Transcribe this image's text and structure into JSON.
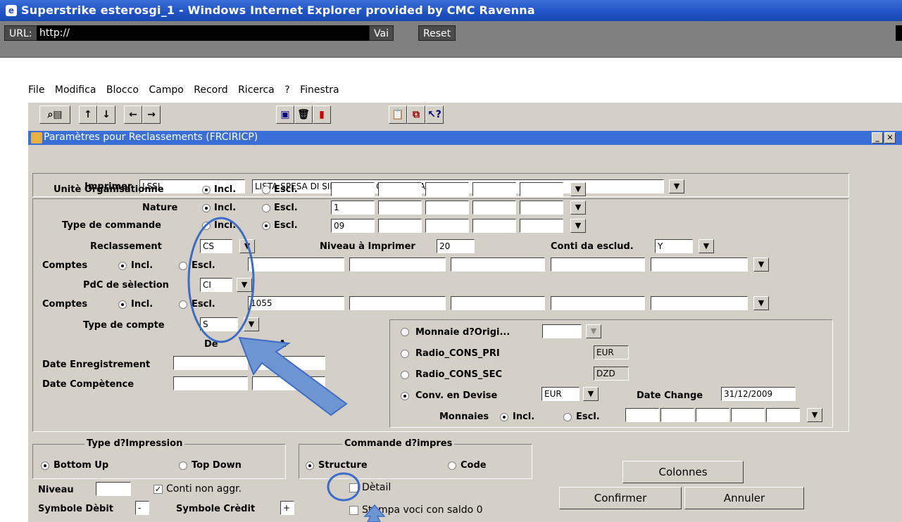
{
  "window": {
    "title": "Superstrike esterosgi_1 - Windows Internet Explorer provided by CMC Ravenna"
  },
  "urlbar": {
    "label": "URL:",
    "value": "http://",
    "go": "Vai",
    "reset": "Reset"
  },
  "menu": [
    "File",
    "Modifica",
    "Blocco",
    "Campo",
    "Record",
    "Ricerca",
    "?",
    "Finestra"
  ],
  "form": {
    "title": "Paramètres pour Reclassements (FRCIRICP)"
  },
  "imprimer": {
    "label": "Imprimer",
    "code": "LSSI",
    "desc": "LISTA SPESA DI SINTESI PER COMMESSA"
  },
  "rows": {
    "unite": {
      "label": "Unitè Organisationne",
      "incl": "Incl.",
      "escl": "Escl.",
      "values": [
        "",
        "",
        "",
        "",
        ""
      ]
    },
    "nature": {
      "label": "Nature",
      "incl": "Incl.",
      "escl": "Escl.",
      "values": [
        "1",
        "",
        "",
        "",
        ""
      ]
    },
    "type_cmd": {
      "label": "Type de commande",
      "incl": "Incl.",
      "escl": "Escl.",
      "values": [
        "09",
        "",
        "",
        "",
        ""
      ]
    }
  },
  "reclassement": {
    "label": "Reclassement",
    "value": "CS"
  },
  "niveau_imprimer": {
    "label": "Niveau à Imprimer",
    "value": "20"
  },
  "conti_esclud": {
    "label": "Conti da esclud.",
    "value": "Y"
  },
  "comptes1": {
    "label": "Comptes",
    "incl": "Incl.",
    "escl": "Escl.",
    "values": [
      "",
      "",
      "",
      "",
      ""
    ]
  },
  "pdc": {
    "label": "PdC de sèlection",
    "value": "CI"
  },
  "comptes2": {
    "label": "Comptes",
    "incl": "Incl.",
    "escl": "Escl.",
    "values": [
      "1055",
      "",
      "",
      "",
      ""
    ]
  },
  "type_compte": {
    "label": "Type de compte",
    "value": "S"
  },
  "dates": {
    "de": "De",
    "a": "A",
    "enreg": "Date Enregistrement",
    "competence": "Date Compètence"
  },
  "monnaie": {
    "origine": "Monnaie d?Origi...",
    "cons_pri": "Radio_CONS_PRI",
    "cons_pri_val": "EUR",
    "cons_sec": "Radio_CONS_SEC",
    "cons_sec_val": "DZD",
    "conv": "Conv. en Devise",
    "conv_val": "EUR",
    "date_change_label": "Date Change",
    "date_change": "31/12/2009",
    "monnaies": "Monnaies",
    "incl": "Incl.",
    "escl": "Escl."
  },
  "type_impression": {
    "title": "Type d?Impression",
    "bottom_up": "Bottom Up",
    "top_down": "Top Down"
  },
  "commande_impres": {
    "title": "Commande d?impres",
    "structure": "Structure",
    "code": "Code"
  },
  "niveau": {
    "label": "Niveau",
    "value": ""
  },
  "conti_non_aggr": "Conti non aggr.",
  "detail": "Dètail",
  "stampa": "Stampa voci con saldo 0",
  "symbole_debit": {
    "label": "Symbole Dèbit",
    "value": "-"
  },
  "symbole_credit": {
    "label": "Symbole Crèdit",
    "value": "+"
  },
  "buttons": {
    "colonnes": "Colonnes",
    "confirmer": "Confirmer",
    "annuler": "Annuler"
  }
}
